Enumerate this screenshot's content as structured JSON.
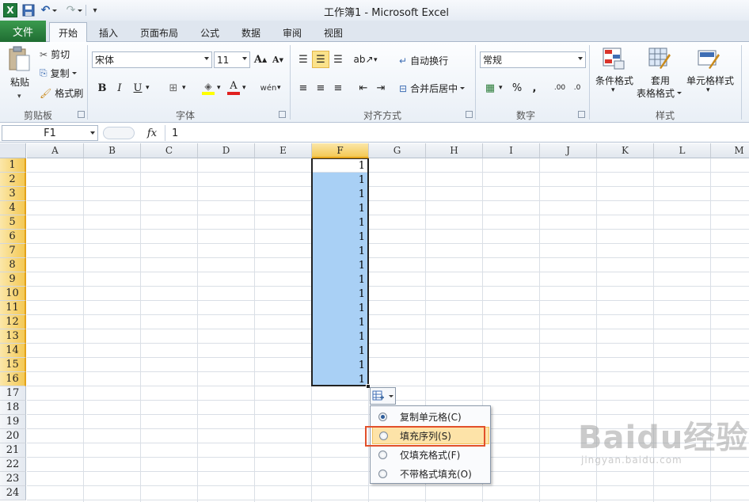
{
  "window": {
    "title": "工作簿1 - Microsoft Excel"
  },
  "tabs": {
    "file": "文件",
    "items": [
      "开始",
      "插入",
      "页面布局",
      "公式",
      "数据",
      "审阅",
      "视图"
    ],
    "active": "开始"
  },
  "ribbon": {
    "clipboard": {
      "paste": "粘贴",
      "cut": "剪切",
      "copy": "复制",
      "format_painter": "格式刷",
      "label": "剪贴板"
    },
    "font": {
      "font_name": "宋体",
      "font_size": "11",
      "bold": "B",
      "italic": "I",
      "underline": "U",
      "label": "字体"
    },
    "alignment": {
      "wrap_text": "自动换行",
      "merge_center": "合并后居中",
      "label": "对齐方式"
    },
    "number": {
      "format": "常规",
      "percent": "%",
      "comma": ",",
      "label": "数字"
    },
    "styles": {
      "conditional": "条件格式",
      "table_line1": "套用",
      "table_line2": "表格格式",
      "cell_styles": "单元格样式",
      "label": "样式"
    }
  },
  "formula_bar": {
    "name_box": "F1",
    "fx": "fx",
    "value": "1"
  },
  "sheet": {
    "columns": [
      "A",
      "B",
      "C",
      "D",
      "E",
      "F",
      "G",
      "H",
      "I",
      "J",
      "K",
      "L",
      "M"
    ],
    "selected_column": "F",
    "rows": [
      "1",
      "2",
      "3",
      "4",
      "5",
      "6",
      "7",
      "8",
      "9",
      "10",
      "11",
      "12",
      "13",
      "14",
      "15",
      "16",
      "17",
      "18",
      "19",
      "20",
      "21",
      "22",
      "23",
      "24"
    ],
    "selected_rows": 16,
    "f_values": [
      "1",
      "1",
      "1",
      "1",
      "1",
      "1",
      "1",
      "1",
      "1",
      "1",
      "1",
      "1",
      "1",
      "1",
      "1",
      "1"
    ]
  },
  "autofill_menu": {
    "options": [
      {
        "label": "复制单元格(C)",
        "checked": true
      },
      {
        "label": "填充序列(S)",
        "checked": false,
        "highlighted": true
      },
      {
        "label": "仅填充格式(F)",
        "checked": false
      },
      {
        "label": "不带格式填充(O)",
        "checked": false
      }
    ]
  },
  "watermark": {
    "brand": "Baidu经验",
    "url": "jingyan.baidu.com"
  },
  "colors": {
    "file_tab": "#2c7a3c",
    "selection": "#a9d0f5",
    "header_selected": "#f4c955",
    "highlight_box": "#e2502b"
  }
}
